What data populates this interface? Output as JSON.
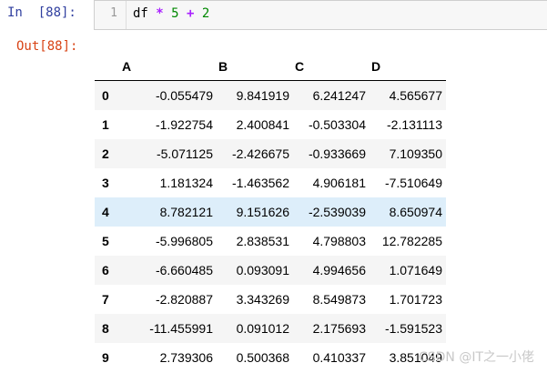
{
  "input_cell": {
    "prompt": "In  [88]:",
    "line_number": "1",
    "code": {
      "var": "df ",
      "op1": "*",
      "mid1": " ",
      "num1": "5",
      "mid2": " ",
      "op2": "+",
      "mid3": " ",
      "num2": "2"
    }
  },
  "output_cell": {
    "prompt": "Out[88]:"
  },
  "dataframe": {
    "columns": [
      "A",
      "B",
      "C",
      "D"
    ],
    "rows": [
      {
        "index": "0",
        "values": [
          "-0.055479",
          "9.841919",
          "6.241247",
          "4.565677"
        ]
      },
      {
        "index": "1",
        "values": [
          "-1.922754",
          "2.400841",
          "-0.503304",
          "-2.131113"
        ]
      },
      {
        "index": "2",
        "values": [
          "-5.071125",
          "-2.426675",
          "-0.933669",
          "7.109350"
        ]
      },
      {
        "index": "3",
        "values": [
          "1.181324",
          "-1.463562",
          "4.906181",
          "-7.510649"
        ]
      },
      {
        "index": "4",
        "values": [
          "8.782121",
          "9.151626",
          "-2.539039",
          "8.650974"
        ]
      },
      {
        "index": "5",
        "values": [
          "-5.996805",
          "2.838531",
          "4.798803",
          "12.782285"
        ]
      },
      {
        "index": "6",
        "values": [
          "-6.660485",
          "0.093091",
          "4.994656",
          "1.071649"
        ]
      },
      {
        "index": "7",
        "values": [
          "-2.820887",
          "3.343269",
          "8.549873",
          "1.701723"
        ]
      },
      {
        "index": "8",
        "values": [
          "-11.455991",
          "0.091012",
          "2.175693",
          "-1.591523"
        ]
      },
      {
        "index": "9",
        "values": [
          "2.739306",
          "0.500368",
          "0.410337",
          "3.851049"
        ]
      }
    ],
    "hovered_row": "4",
    "colors": {
      "hover": "#ddeefa",
      "stripe": "#f5f5f5",
      "in_prompt": "#303f9f",
      "out_prompt": "#d84315"
    }
  },
  "watermark": "CSDN @IT之一小佬"
}
